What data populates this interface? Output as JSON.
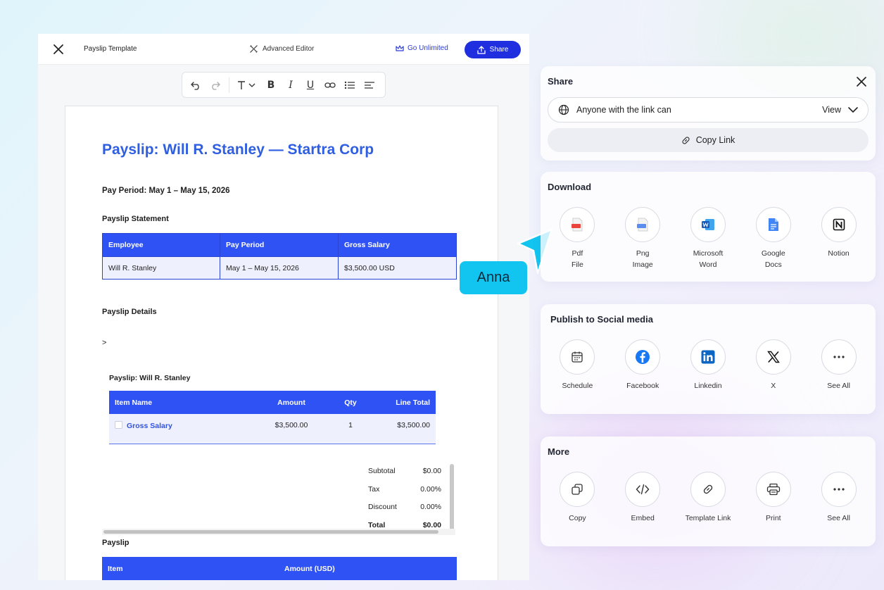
{
  "editor": {
    "doc_title": "Payslip Template",
    "advanced_editor": "Advanced Editor",
    "go_unlimited": "Go Unlimited",
    "share": "Share"
  },
  "document": {
    "title": "Payslip: Will R. Stanley — Startra Corp",
    "pay_period": "Pay Period: May 1 – May 15, 2026",
    "statement_label": "Payslip Statement",
    "statement_table": {
      "headers": [
        "Employee",
        "Pay Period",
        "Gross Salary"
      ],
      "row": [
        "Will R. Stanley",
        "May 1 – May 15, 2026",
        "$3,500.00 USD"
      ]
    },
    "details_label": "Payslip Details",
    "caret": ">",
    "inner_title": "Payslip: Will R. Stanley",
    "items_table": {
      "headers": [
        "Item Name",
        "Amount",
        "Qty",
        "Line Total"
      ],
      "row": {
        "name": "Gross Salary",
        "amount": "$3,500.00",
        "qty": "1",
        "line_total": "$3,500.00"
      }
    },
    "totals": [
      {
        "label": "Subtotal",
        "value": "$0.00"
      },
      {
        "label": "Tax",
        "value": "0.00%"
      },
      {
        "label": "Discount",
        "value": "0.00%"
      },
      {
        "label": "Total",
        "value": "$0.00"
      }
    ],
    "payslip_label": "Payslip",
    "payslip_table": {
      "headers": [
        "Item",
        "Amount (USD)"
      ]
    }
  },
  "collaborator": "Anna",
  "share_panel": {
    "title": "Share",
    "access": "Anyone with the link can",
    "permission": "View",
    "copy_link": "Copy Link"
  },
  "download_panel": {
    "title": "Download",
    "options": [
      "Pdf\nFile",
      "Png\nImage",
      "Microsoft\nWord",
      "Google\nDocs",
      "Notion"
    ]
  },
  "social_panel": {
    "title": "Publish to Social media",
    "options": [
      "Schedule",
      "Facebook",
      "Linkedin",
      "X",
      "See All"
    ]
  },
  "more_panel": {
    "title": "More",
    "options": [
      "Copy",
      "Embed",
      "Template Link",
      "Print",
      "See All"
    ]
  },
  "colors": {
    "accent": "#1f2fe0",
    "table_header": "#2f52f5",
    "heading": "#2f5fe0",
    "collaborator": "#12c4f0"
  }
}
